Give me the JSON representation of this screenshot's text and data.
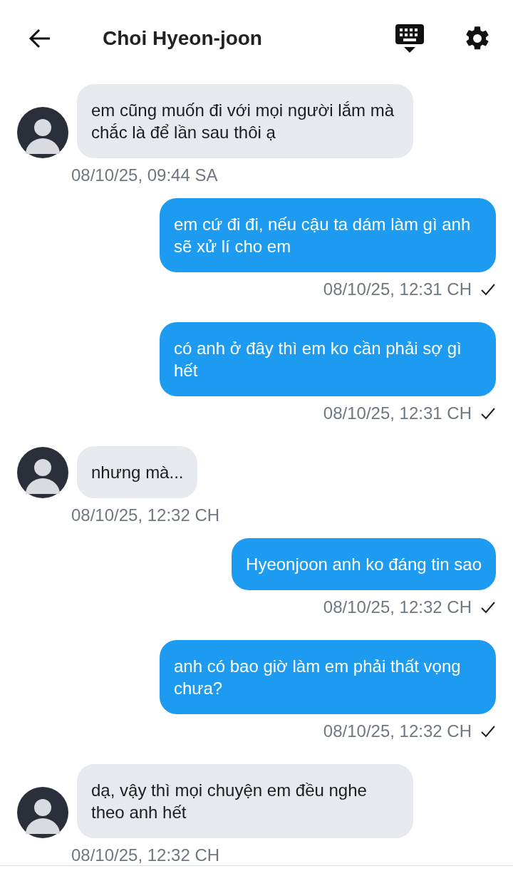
{
  "header": {
    "title": "Choi Hyeon-joon"
  },
  "messages": [
    {
      "kind": "received",
      "text": "em cũng muốn đi với mọi người lắm mà chắc là để lần sau thôi ạ",
      "time": "08/10/25, 09:44 SA"
    },
    {
      "kind": "sent",
      "text": "em cứ đi đi, nếu cậu ta dám làm gì anh sẽ xử lí cho em",
      "time": "08/10/25, 12:31 CH",
      "delivered": true
    },
    {
      "kind": "sent",
      "text": "có anh ở đây thì em ko cần phải sợ gì hết",
      "time": "08/10/25, 12:31 CH",
      "delivered": true
    },
    {
      "kind": "received",
      "text": "nhưng mà...",
      "time": "08/10/25, 12:32 CH"
    },
    {
      "kind": "sent",
      "text": "Hyeonjoon anh ko đáng tin sao",
      "time": "08/10/25, 12:32 CH",
      "delivered": true
    },
    {
      "kind": "sent",
      "text": "anh có bao giờ làm em phải thất vọng chưa?",
      "time": "08/10/25, 12:32 CH",
      "delivered": true
    },
    {
      "kind": "received",
      "text": "dạ, vậy thì mọi chuyện em đều nghe theo anh hết",
      "time": "08/10/25, 12:32 CH"
    }
  ]
}
